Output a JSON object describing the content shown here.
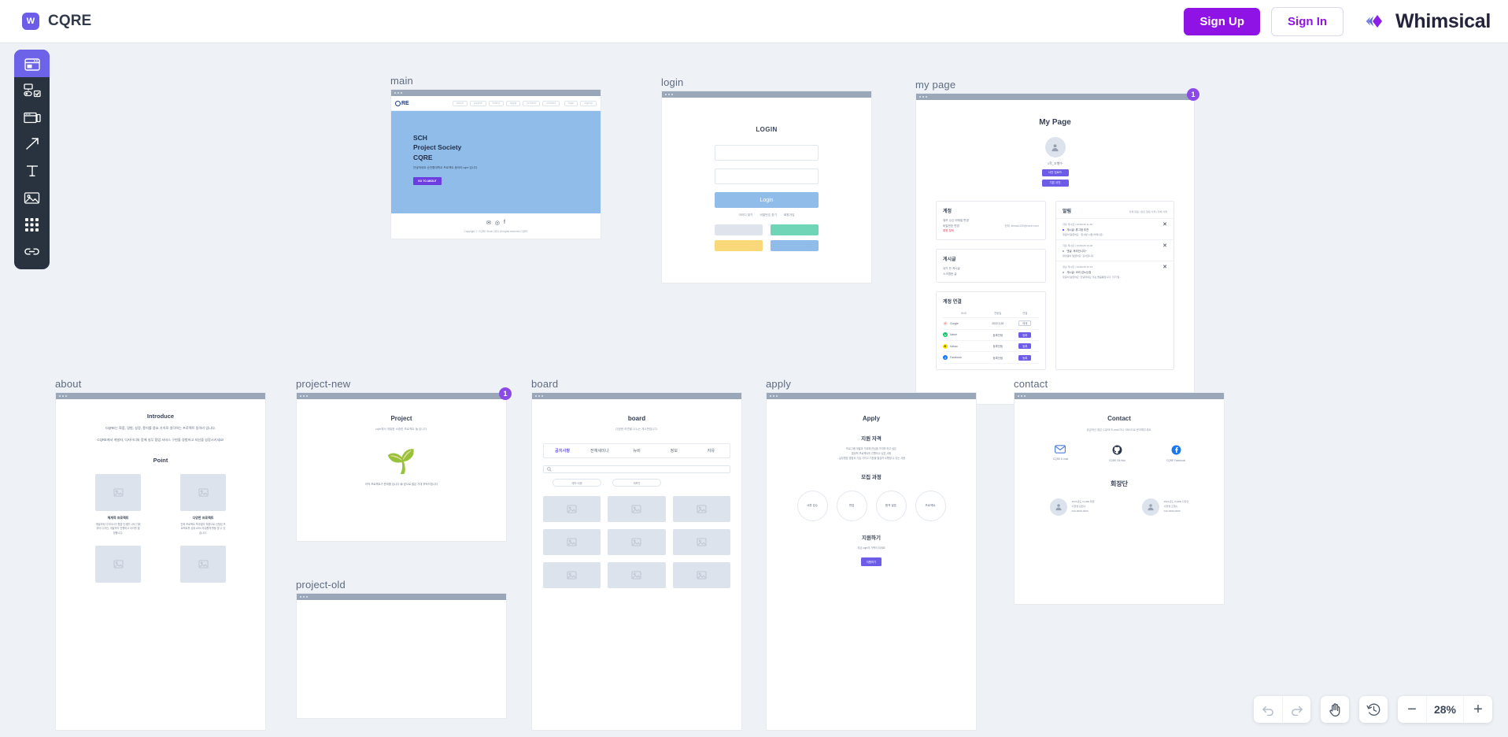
{
  "topbar": {
    "brand_badge": "W",
    "brand_title": "CQRE",
    "sign_up": "Sign Up",
    "sign_in": "Sign In",
    "product_name": "Whimsical"
  },
  "toolbar": {
    "items": [
      {
        "name": "wireframe-tool",
        "active": true
      },
      {
        "name": "form-controls-tool",
        "active": false
      },
      {
        "name": "window-tool",
        "active": false
      },
      {
        "name": "arrow-tool",
        "active": false
      },
      {
        "name": "text-tool",
        "active": false
      },
      {
        "name": "image-tool",
        "active": false
      },
      {
        "name": "grid-tool",
        "active": false
      },
      {
        "name": "link-tool",
        "active": false
      }
    ]
  },
  "frames": {
    "main": {
      "label": "main",
      "logo": "RE",
      "nav": [
        "about",
        "project",
        "board",
        "apply",
        "product",
        "contact"
      ],
      "nav_right": [
        "login",
        "signup"
      ],
      "hero_line1": "SCH",
      "hero_line2": "Project Society",
      "hero_line3": "CQRE",
      "hero_desc": "안녕하세요 순천향대학교 프로젝트 동아리 cqre 입니다",
      "hero_cta": "GO TO ABOUT",
      "social": [
        "✉",
        "◎",
        "f"
      ],
      "copyright": "Copyright ⓒ CQRE Since 2021 All rights reserved CQRE"
    },
    "login": {
      "label": "login",
      "title": "LOGIN",
      "id_placeholder": "",
      "pw_placeholder": "",
      "button": "Login",
      "links": [
        "아이디 찾기",
        "비밀번호 찾기",
        "회원가입"
      ],
      "social_buttons": [
        {
          "name": "google-login",
          "color": "#dfe4ec"
        },
        {
          "name": "naver-login",
          "color": "#6fd5b6"
        },
        {
          "name": "kakao-login",
          "color": "#f8d878"
        },
        {
          "name": "facebook-login",
          "color": "#8fbce8"
        }
      ]
    },
    "mypage": {
      "label": "my page",
      "badge": "1",
      "title": "My Page",
      "user_name": "1학_조행수",
      "btn_upload": "사진 업로드",
      "btn_default": "기본 사진",
      "account_card": {
        "title": "계정",
        "line1": "정보 수신 이메일 변경",
        "line2": "비밀번호 변경",
        "line3": "회원 탈퇴",
        "email": "현재: khsss0439@naver.com"
      },
      "post_card": {
        "title": "게시글",
        "line1": "내가 쓴 게시글",
        "line2": "스크랩한 글"
      },
      "link_card": {
        "title": "계정 연결",
        "headers": [
          "SNS",
          "연동일",
          "연결"
        ],
        "rows": [
          {
            "sns": "Google",
            "letter": "G",
            "color": "#ea4335",
            "date": "2022.3.26",
            "action": "해제",
            "filled": false
          },
          {
            "sns": "Naver",
            "letter": "N",
            "color": "#03c75a",
            "date": "등록안됨",
            "action": "등록",
            "filled": true
          },
          {
            "sns": "Kakao",
            "letter": "K",
            "color": "#fee500",
            "date": "등록안됨",
            "action": "등록",
            "filled": true
          },
          {
            "sns": "Facebook",
            "letter": "f",
            "color": "#1877f2",
            "date": "등록안됨",
            "action": "등록",
            "filled": true
          }
        ]
      },
      "alarm": {
        "title": "알림",
        "actions": "전체 읽음  |  읽은 알림 삭제  |  전체 삭제",
        "items": [
          {
            "board": "자유 게시판",
            "time": "22/03/30 11:30",
            "t1": "게시글: 휴그잠 추천",
            "t2": "댓글이 달렸어요 : 한사랑 시럽 어때나죠!"
          },
          {
            "board": "자유 게시판",
            "time": "22/03/29 15:20",
            "t1": "댓글: 후라인니다~",
            "t2": "대댓글이 달렸어요: 감사합니다"
          },
          {
            "board": "정보 게시판",
            "time": "22/03/28 10:19",
            "t1": "게시글: 코리 갑노는집",
            "t2": "댓글이 달렸어요: 안녕하세요 저는 돌음통입니다. 저기 말..."
          }
        ]
      }
    },
    "about": {
      "label": "about",
      "h1": "Introduce",
      "p1": "CQRE는 화합, 경험, 성장, 흥미를 중요 가치로 생각하는 프로젝트 동아리 입니다.",
      "p2": "CQRE에서 개발자, 디자이너와 함께 실무 협업 서비스 구현을 경험하고 자신을 성장시키세요!",
      "h2": "Point",
      "cells": [
        {
          "title": "체계적 프로젝트",
          "desc": "개발자와 디자이너가 협업 단계를 나눠 기획부터 디자인, 개발까지 진행하고 아이를 결정합니다."
        },
        {
          "title": "다양한 프로젝트",
          "desc": "진짜 프로젝트 학과생이 작품으로 신청된 프로젝트를 상위 60% 자유롭게 활동 할 수 있습니다."
        }
      ]
    },
    "project_new": {
      "label": "project-new",
      "badge": "1",
      "h1": "Project",
      "sub": "cqre에서 개발한 소중한 프로젝트 들 입니다.",
      "plant": "🌱",
      "note": "아직 프로젝트가 준비중 입니다 😅\n 앞으로 많은 기대 부탁드립니다"
    },
    "project_old": {
      "label": "project-old"
    },
    "board": {
      "label": "board",
      "h1": "board",
      "sub": "다양한 의견을 나누는 게시판입니다.",
      "tabs": [
        "공지사항",
        "전체세미나",
        "뉴비",
        "정보",
        "자유"
      ],
      "active_tab": "공지사항",
      "search_placeholder": "",
      "chips": [
        "제목+내용",
        "제목만"
      ],
      "tile_count": 9
    },
    "apply": {
      "label": "apply",
      "h1": "Apply",
      "h2": "지원 자격",
      "p1": "프로그램 개발과 기획에 관심을 가지며 하고 싶은\n 열정적 프로젝트를 진행하고 싶은 사람\n - 실무협업 경험과 기술 가지고 기본을 열심히 수행할 수 있는 사람",
      "h3": "모집 과정",
      "steps": [
        "서류 접수",
        "면접",
        "합격 발표",
        "프로젝트"
      ],
      "h4": "지원하기",
      "p2": "지금 cqre의 가족이 되세요",
      "button": "지원하기"
    },
    "contact": {
      "label": "contact",
      "h1": "Contact",
      "sub": "궁금하신 점은 CQRE E-mail 이나 SNS으로 문의해주세요.",
      "icons": [
        {
          "name": "email-icon",
          "label": "CQRE E-mail",
          "glyph": "✉",
          "color": "#4f7fd6"
        },
        {
          "name": "github-icon",
          "label": "CQRE Git Hub",
          "glyph": "●",
          "color": "#2b3648"
        },
        {
          "name": "facebook-icon",
          "label": "CQRE Facebook",
          "glyph": "f",
          "color": "#1877f2"
        }
      ],
      "h2": "회장단",
      "people": [
        {
          "name": "avatar",
          "line1": "2021년도 CQRE 회장",
          "line2": "사항명 김현수",
          "line3": "010-0000-0000"
        },
        {
          "name": "avatar",
          "line1": "2021년도 CQRE 디자인",
          "line2": "사항명 조행수",
          "line3": "010-0000-0000"
        }
      ]
    }
  },
  "controls": {
    "undo": "undo-icon",
    "redo": "redo-icon",
    "hand": "hand-tool-icon",
    "history": "history-icon",
    "zoom_out": "−",
    "zoom_value": "28%",
    "zoom_in": "+"
  }
}
